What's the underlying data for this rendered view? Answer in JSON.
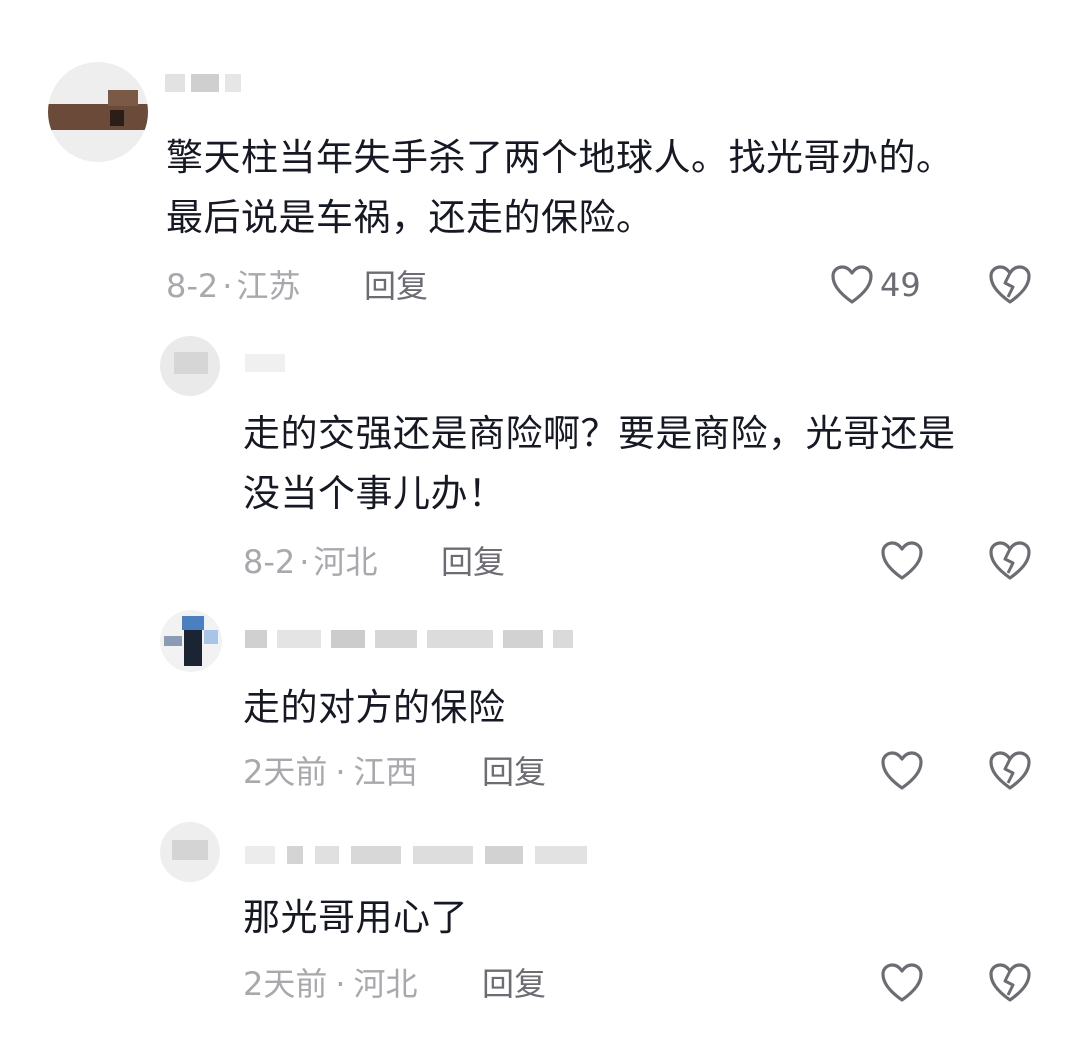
{
  "comments": [
    {
      "text": "擎天柱当年失手杀了两个地球人。找光哥办的。\n最后说是车祸，还走的保险。",
      "date": "8-2",
      "separator": "·",
      "location": "江苏",
      "reply_label": "回复",
      "likes": "49"
    },
    {
      "text": "走的交强还是商险啊？要是商险，光哥还是\n没当个事儿办！",
      "date": "8-2",
      "separator": "·",
      "location": "河北",
      "reply_label": "回复",
      "likes": ""
    },
    {
      "text": "走的对方的保险",
      "date": "2天前",
      "separator": "·",
      "location": "江西",
      "reply_label": "回复",
      "likes": ""
    },
    {
      "text": "那光哥用心了",
      "date": "2天前",
      "separator": "·",
      "location": "河北",
      "reply_label": "回复",
      "likes": ""
    }
  ],
  "icons": {
    "like": "heart-outline-icon",
    "dislike": "broken-heart-icon"
  },
  "colors": {
    "text": "#161823",
    "meta": "#a8a8ad",
    "icon": "#6c6c73"
  }
}
